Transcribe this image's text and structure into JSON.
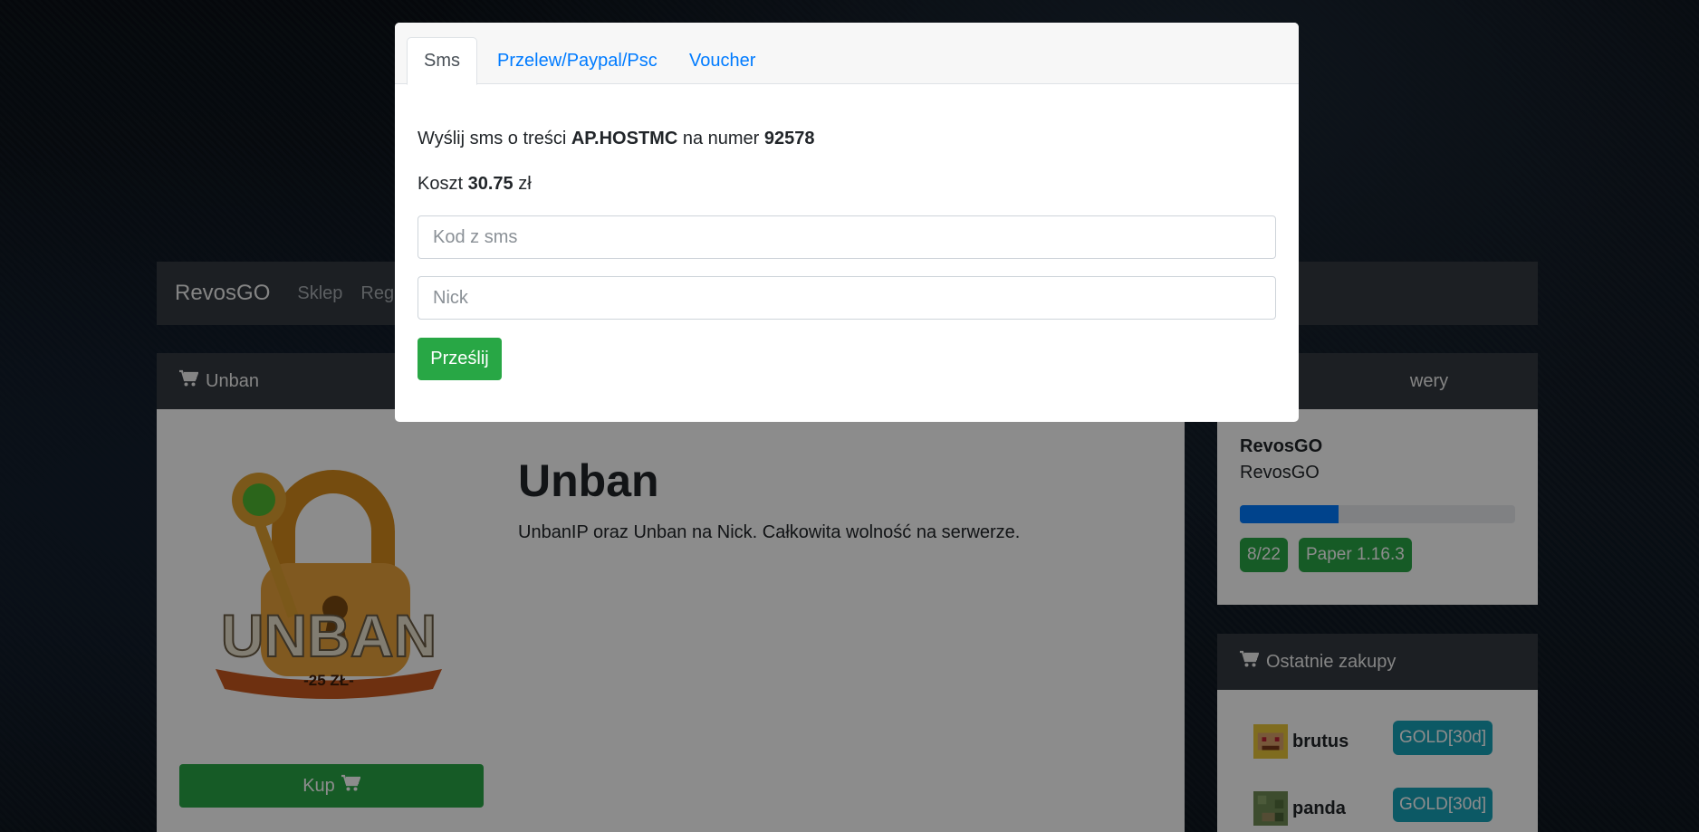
{
  "navbar": {
    "brand": "RevosGO",
    "links": [
      "Sklep",
      "Regu"
    ]
  },
  "product_card": {
    "header": "Unban",
    "title": "Unban",
    "description": "UnbanIP oraz Unban na Nick. Całkowita wolność na serwerze.",
    "buy_label": "Kup",
    "image_text": "UNBAN",
    "image_price": "-25 ZŁ-"
  },
  "servers_card": {
    "header_fragment": "wery",
    "server_name": "RevosGO",
    "server_sub": "RevosGO",
    "players_fraction": 0.36,
    "players": "8/22",
    "version": "Paper 1.16.3"
  },
  "purchases_card": {
    "header": "Ostatnie zakupy",
    "items": [
      {
        "buyer": "brutus",
        "item": "GOLD[30d]"
      },
      {
        "buyer": "panda",
        "item": "GOLD[30d]"
      }
    ]
  },
  "modal": {
    "tabs": [
      "Sms",
      "Przelew/Paypal/Psc",
      "Voucher"
    ],
    "active_tab": "Sms",
    "sms_prefix": "Wyślij sms o treści",
    "sms_code": "AP.HOSTMC",
    "sms_middle": "na numer",
    "sms_number": "92578",
    "cost_prefix": "Koszt",
    "cost_value": "30.75",
    "cost_suffix": "zł",
    "code_placeholder": "Kod z sms",
    "nick_placeholder": "Nick",
    "submit_label": "Prześlij"
  },
  "colors": {
    "success": "#28a745",
    "primary": "#007bff",
    "info": "#17a2b8",
    "dark": "#343a40"
  },
  "icons": [
    "shopping-cart-icon"
  ]
}
